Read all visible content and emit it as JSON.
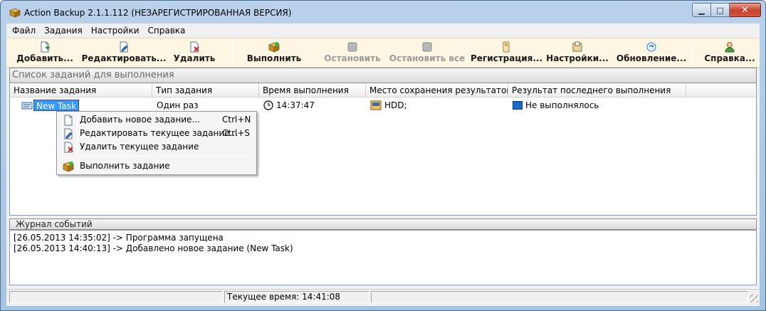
{
  "window": {
    "title": "Action Backup 2.1.1.112 (НЕЗАРЕГИСТРИРОВАННАЯ ВЕРСИЯ)",
    "minimize": "▁",
    "maximize": "□",
    "close": "✕"
  },
  "menubar": [
    "Файл",
    "Задания",
    "Настройки",
    "Справка"
  ],
  "toolbar": {
    "add": "Добавить...",
    "edit": "Редактировать...",
    "delete": "Удалить",
    "run": "Выполнить",
    "stop": "Остановить",
    "stop_all": "Остановить все",
    "register": "Регистрация...",
    "settings": "Настройки...",
    "update": "Обновление...",
    "help": "Справка..."
  },
  "tasklist": {
    "header": "Список заданий для выполнения",
    "columns": [
      "Название задания",
      "Тип задания",
      "Время выполнения",
      "Место сохранения результатов",
      "Результат последнего выполнения"
    ],
    "rows": [
      {
        "name": "New Task",
        "type": "Один раз",
        "time": "14:37:47",
        "location": "HDD;",
        "result": "Не выполнялось"
      }
    ]
  },
  "context_menu": {
    "items": [
      {
        "label": "Добавить новое задание...",
        "shortcut": "Ctrl+N",
        "icon": "add-task-icon"
      },
      {
        "label": "Редактировать текущее задание...",
        "shortcut": "Ctrl+S",
        "icon": "edit-task-icon"
      },
      {
        "label": "Удалить текущее задание",
        "shortcut": "",
        "icon": "delete-task-icon"
      },
      {
        "label": "Выполнить задание",
        "shortcut": "",
        "icon": "run-task-icon"
      }
    ]
  },
  "log": {
    "header": "Журнал событий",
    "lines": [
      "[26.05.2013 14:35:02] -> Программа запущена",
      "[26.05.2013 14:40:13] -> Добавлено новое задание  (New Task)"
    ]
  },
  "statusbar": {
    "current_time": "Текущее время: 14:41:08"
  },
  "colors": {
    "selection": "#3399ff",
    "toolbar_bg": "#fdf6e2",
    "titlebar": "#b9d1ea"
  }
}
